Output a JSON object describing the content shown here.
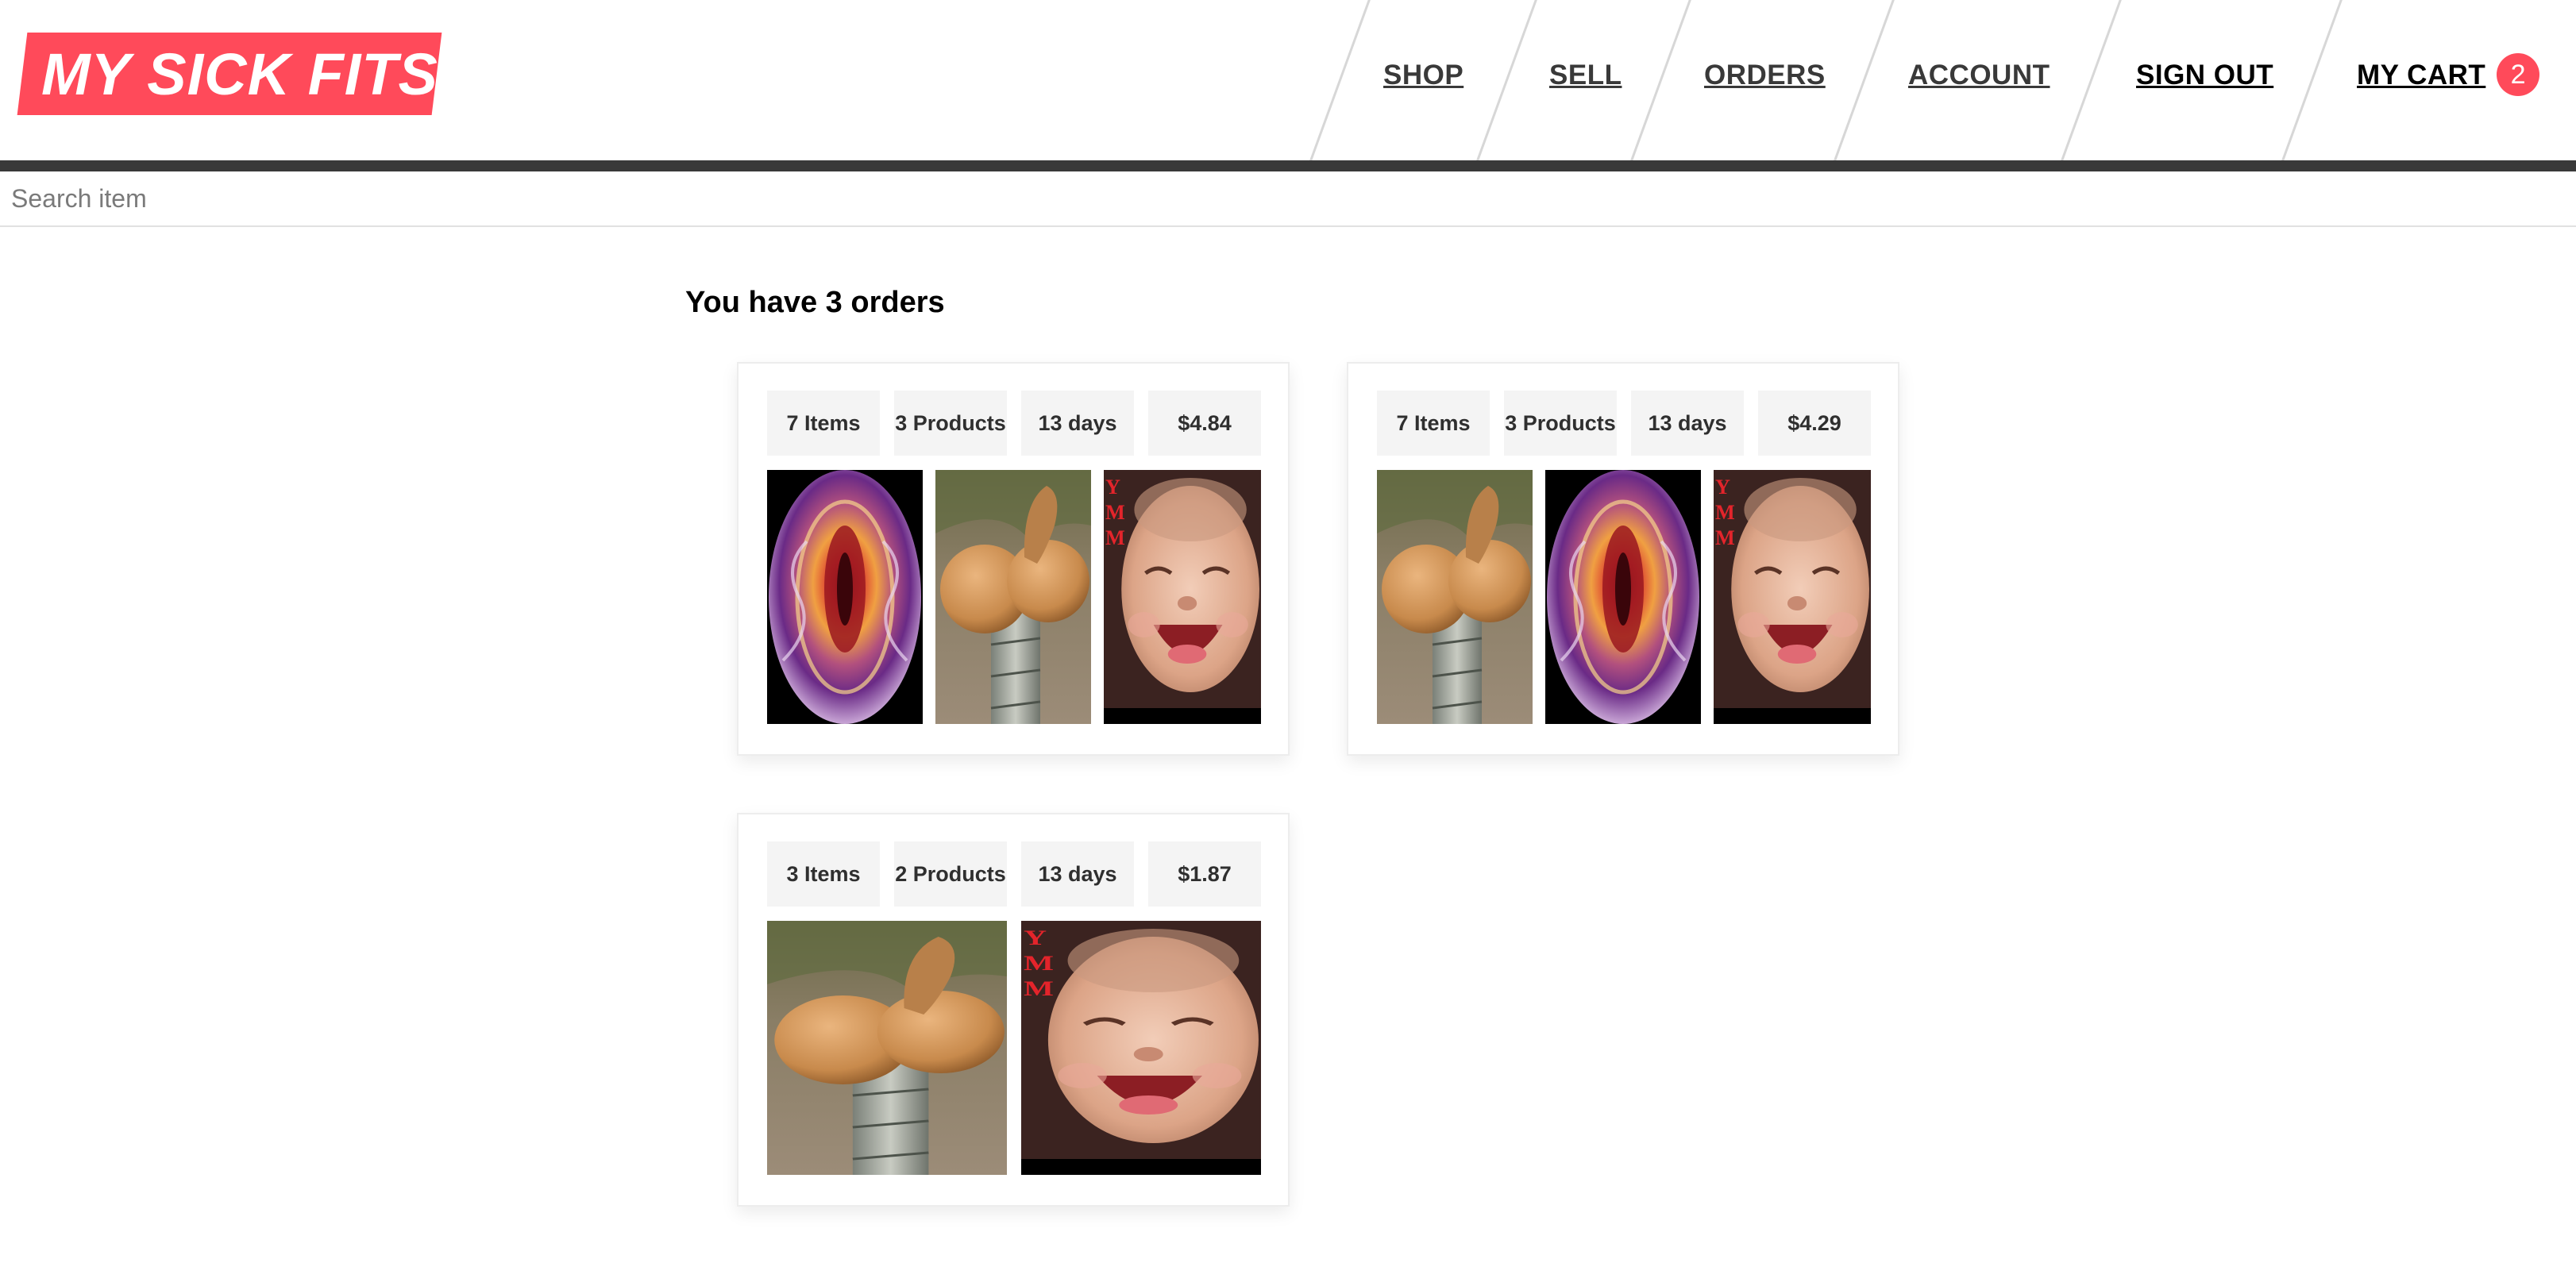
{
  "brand": {
    "logo_text": "MY SICK FITS",
    "accent": "#ff4a5a"
  },
  "nav": {
    "shop": "SHOP",
    "sell": "SELL",
    "orders": "ORDERS",
    "account": "ACCOUNT",
    "sign_out": "SIGN OUT",
    "cart_label": "MY CART",
    "cart_count": "2"
  },
  "search": {
    "placeholder": "Search item",
    "value": ""
  },
  "orders_page": {
    "title": "You have 3 orders",
    "orders": [
      {
        "items": "7 Items",
        "products": "3 Products",
        "age": "13 days",
        "total": "$4.84",
        "images": [
          "abstract-orb-image",
          "gourd-tree-image",
          "laughing-baby-image"
        ]
      },
      {
        "items": "7 Items",
        "products": "3 Products",
        "age": "13 days",
        "total": "$4.29",
        "images": [
          "gourd-tree-image",
          "abstract-orb-image",
          "laughing-baby-image"
        ]
      },
      {
        "items": "3 Items",
        "products": "2 Products",
        "age": "13 days",
        "total": "$1.87",
        "images": [
          "gourd-tree-image",
          "laughing-baby-image"
        ]
      }
    ]
  }
}
